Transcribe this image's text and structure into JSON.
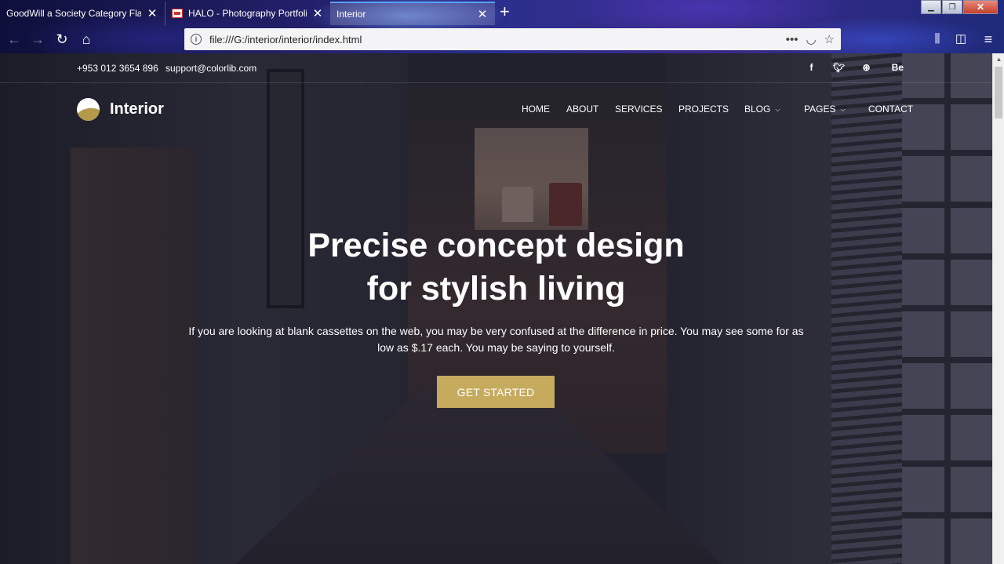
{
  "browser": {
    "tabs": [
      {
        "title": "GoodWill a Society Category Flat B"
      },
      {
        "title": "HALO - Photography Portfolio"
      },
      {
        "title": "Interior"
      }
    ],
    "url": "file:///G:/interior/interior/index.html"
  },
  "site": {
    "phone": "+953 012 3654 896",
    "email": "support@colorlib.com",
    "socials": [
      "f",
      "t",
      "d",
      "Be"
    ],
    "brand": "Interior",
    "nav": [
      {
        "label": "HOME"
      },
      {
        "label": "ABOUT"
      },
      {
        "label": "SERVICES"
      },
      {
        "label": "PROJECTS"
      },
      {
        "label": "BLOG"
      },
      {
        "label": "PAGES"
      },
      {
        "label": "CONTACT"
      }
    ],
    "hero": {
      "title_line1": "Precise concept design",
      "title_line2": "for stylish living",
      "text": "If you are looking at blank cassettes on the web, you may be very confused at the difference in price. You may see some for as low as $.17 each. You may be saying to yourself.",
      "cta": "GET STARTED"
    },
    "colors": {
      "accent": "#c6aa5e"
    }
  }
}
